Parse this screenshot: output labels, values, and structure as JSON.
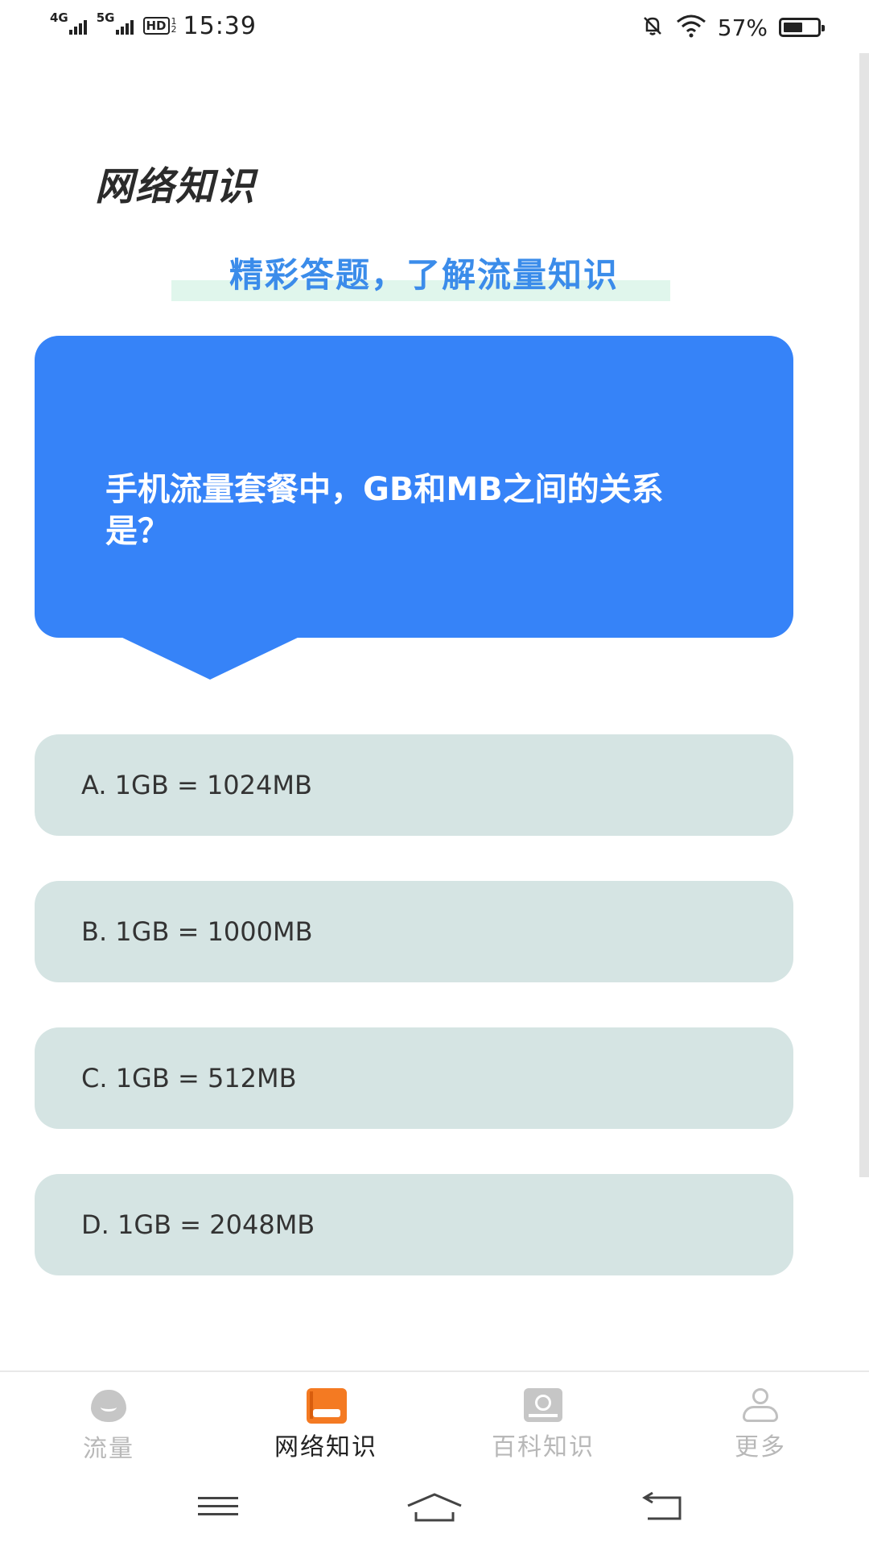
{
  "status_bar": {
    "network1": "4G",
    "network2": "5G",
    "hd": "HD",
    "hd_sub_top": "1",
    "hd_sub_bottom": "2",
    "time": "15:39",
    "battery_text": "57%",
    "battery_level": 0.57
  },
  "header": {
    "title": "网络知识",
    "subtitle": "精彩答题，了解流量知识"
  },
  "question": {
    "text": "手机流量套餐中，GB和MB之间的关系是？"
  },
  "options": [
    {
      "label": "A. 1GB = 1024MB"
    },
    {
      "label": "B. 1GB = 1000MB"
    },
    {
      "label": "C. 1GB = 512MB"
    },
    {
      "label": "D. 1GB = 2048MB"
    }
  ],
  "tabs": [
    {
      "label": "流量",
      "icon": "traffic-icon",
      "active": false
    },
    {
      "label": "网络知识",
      "icon": "book-icon",
      "active": true
    },
    {
      "label": "百科知识",
      "icon": "encyclopedia-icon",
      "active": false
    },
    {
      "label": "更多",
      "icon": "user-icon",
      "active": false
    }
  ],
  "colors": {
    "primary_blue": "#3683f8",
    "option_bg": "#d5e4e3",
    "subtitle_blue": "#3b8cea",
    "active_tab_icon": "#f47a22"
  }
}
